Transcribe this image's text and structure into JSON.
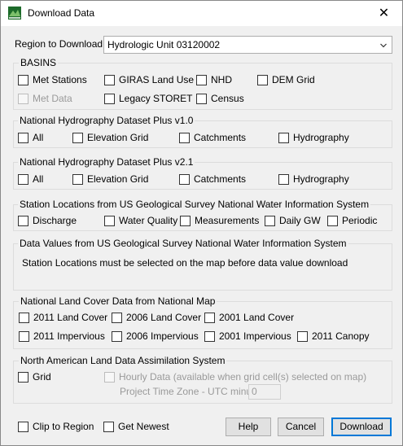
{
  "window": {
    "title": "Download Data",
    "close_glyph": "✕"
  },
  "region": {
    "label": "Region to Download",
    "selected": "Hydrologic Unit 03120002"
  },
  "basins": {
    "title": "BASINS",
    "met_stations": "Met Stations",
    "giras": "GIRAS Land Use",
    "nhd": "NHD",
    "dem": "DEM Grid",
    "met_data": "Met Data",
    "legacy_storet": "Legacy STORET",
    "census": "Census"
  },
  "nhd_v1": {
    "title": "National Hydrography Dataset Plus v1.0",
    "all": "All",
    "elevation": "Elevation Grid",
    "catchments": "Catchments",
    "hydrography": "Hydrography"
  },
  "nhd_v2": {
    "title": "National Hydrography Dataset Plus v2.1",
    "all": "All",
    "elevation": "Elevation Grid",
    "catchments": "Catchments",
    "hydrography": "Hydrography"
  },
  "usgs_stations": {
    "title": "Station Locations from US Geological Survey National Water Information System",
    "discharge": "Discharge",
    "water_quality": "Water Quality",
    "measurements": "Measurements",
    "daily_gw": "Daily GW",
    "periodic": "Periodic"
  },
  "usgs_values": {
    "title": "Data Values from US Geological Survey National Water Information System",
    "message": "Station Locations must be selected on the map before data value download"
  },
  "nlcd": {
    "title": "National Land Cover Data from National Map",
    "lc2011": "2011 Land Cover",
    "lc2006": "2006 Land Cover",
    "lc2001": "2001 Land Cover",
    "imp2011": "2011 Impervious",
    "imp2006": "2006 Impervious",
    "imp2001": "2001 Impervious",
    "canopy2011": "2011 Canopy"
  },
  "nldas": {
    "title": "North American Land Data Assimilation System",
    "grid": "Grid",
    "hourly": "Hourly Data (available when grid cell(s) selected on map)",
    "tz_label": "Project Time Zone - UTC minus",
    "tz_value": "0"
  },
  "footer": {
    "clip": "Clip to Region",
    "newest": "Get Newest",
    "help": "Help",
    "cancel": "Cancel",
    "download": "Download"
  },
  "colors": {
    "accent": "#0078d7",
    "disabled_text": "#9a9a9a"
  },
  "icons": {
    "app": "basins-app-icon",
    "dropdown": "chevron-down-icon",
    "close": "close-icon"
  }
}
